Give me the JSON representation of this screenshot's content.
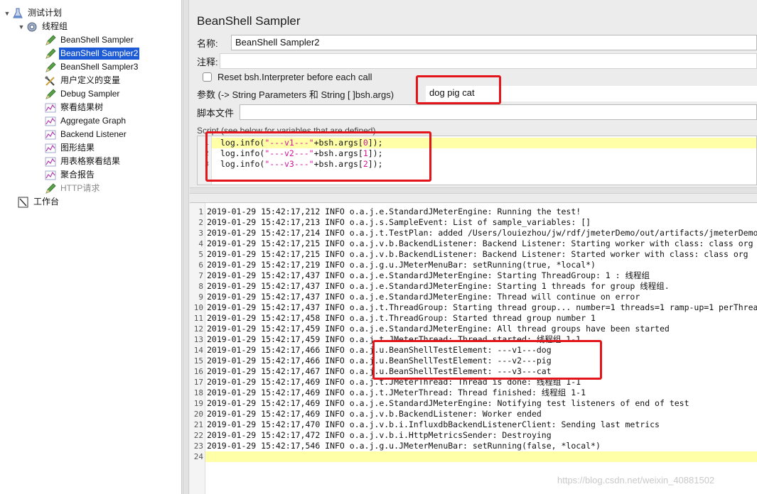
{
  "tree": {
    "root": "测试计划",
    "thread_group": "线程组",
    "items": [
      {
        "label": "BeanShell Sampler",
        "icon": "pencil-icon"
      },
      {
        "label": "BeanShell Sampler2",
        "icon": "pencil-icon",
        "selected": true
      },
      {
        "label": "BeanShell Sampler3",
        "icon": "pencil-icon"
      },
      {
        "label": "用户定义的变量",
        "icon": "tools-icon"
      },
      {
        "label": "Debug Sampler",
        "icon": "pencil-icon"
      },
      {
        "label": "察看结果树",
        "icon": "graph-icon"
      },
      {
        "label": "Aggregate Graph",
        "icon": "graph-icon"
      },
      {
        "label": "Backend Listener",
        "icon": "graph-icon"
      },
      {
        "label": "图形结果",
        "icon": "graph-icon"
      },
      {
        "label": "用表格察看结果",
        "icon": "graph-icon"
      },
      {
        "label": "聚合报告",
        "icon": "graph-icon"
      },
      {
        "label": "HTTP请求",
        "icon": "pencil-icon",
        "disabled": true
      }
    ],
    "workbench": "工作台"
  },
  "panel": {
    "title": "BeanShell Sampler",
    "name_label": "名称:",
    "name_value": "BeanShell Sampler2",
    "comment_label": "注释:",
    "reset_label": "Reset bsh.Interpreter before each call",
    "params_label": "参数 (-> String Parameters 和 String [ ]bsh.args)",
    "params_value": "dog pig cat",
    "script_file_label": "脚本文件",
    "script_label": "Script (see below for variables that are defined)",
    "script_lines": [
      {
        "num": "1",
        "pre": "log.info(",
        "str": "\"---v1---\"",
        "mid": "+bsh.args[",
        "idx": "0",
        "post": "]);"
      },
      {
        "num": "2",
        "pre": "log.info(",
        "str": "\"---v2---\"",
        "mid": "+bsh.args[",
        "idx": "1",
        "post": "]);"
      },
      {
        "num": "3",
        "pre": "log.info(",
        "str": "\"---v3---\"",
        "mid": "+bsh.args[",
        "idx": "2",
        "post": "]);"
      }
    ]
  },
  "log": {
    "lines": [
      "2019-01-29 15:42:17,212 INFO o.a.j.e.StandardJMeterEngine: Running the test!",
      "2019-01-29 15:42:17,213 INFO o.a.j.s.SampleEvent: List of sample_variables: []",
      "2019-01-29 15:42:17,214 INFO o.a.j.t.TestPlan: added /Users/louiezhou/jw/rdf/jmeterDemo/out/artifacts/jmeterDemo",
      "2019-01-29 15:42:17,215 INFO o.a.j.v.b.BackendListener: Backend Listener: Starting worker with class: class org",
      "2019-01-29 15:42:17,215 INFO o.a.j.v.b.BackendListener: Backend Listener: Started  worker with class: class org",
      "2019-01-29 15:42:17,219 INFO o.a.j.g.u.JMeterMenuBar: setRunning(true, *local*)",
      "2019-01-29 15:42:17,437 INFO o.a.j.e.StandardJMeterEngine: Starting ThreadGroup: 1 : 线程组",
      "2019-01-29 15:42:17,437 INFO o.a.j.e.StandardJMeterEngine: Starting 1 threads for group 线程组.",
      "2019-01-29 15:42:17,437 INFO o.a.j.e.StandardJMeterEngine: Thread will continue on error",
      "2019-01-29 15:42:17,437 INFO o.a.j.t.ThreadGroup: Starting thread group... number=1 threads=1 ramp-up=1 perThrea",
      "2019-01-29 15:42:17,458 INFO o.a.j.t.ThreadGroup: Started thread group number 1",
      "2019-01-29 15:42:17,459 INFO o.a.j.e.StandardJMeterEngine: All thread groups have been started",
      "2019-01-29 15:42:17,459 INFO o.a.j.t.JMeterThread: Thread started: 线程组 1-1",
      "2019-01-29 15:42:17,466 INFO o.a.j.u.BeanShellTestElement: ---v1---dog",
      "2019-01-29 15:42:17,466 INFO o.a.j.u.BeanShellTestElement: ---v2---pig",
      "2019-01-29 15:42:17,467 INFO o.a.j.u.BeanShellTestElement: ---v3---cat",
      "2019-01-29 15:42:17,469 INFO o.a.j.t.JMeterThread: Thread is done: 线程组 1-1",
      "2019-01-29 15:42:17,469 INFO o.a.j.t.JMeterThread: Thread finished: 线程组 1-1",
      "2019-01-29 15:42:17,469 INFO o.a.j.e.StandardJMeterEngine: Notifying test listeners of end of test",
      "2019-01-29 15:42:17,469 INFO o.a.j.v.b.BackendListener: Worker ended",
      "2019-01-29 15:42:17,470 INFO o.a.j.v.b.i.InfluxdbBackendListenerClient: Sending last metrics",
      "2019-01-29 15:42:17,472 INFO o.a.j.v.b.i.HttpMetricsSender: Destroying",
      "2019-01-29 15:42:17,546 INFO o.a.j.g.u.JMeterMenuBar: setRunning(false, *local*)",
      ""
    ]
  },
  "watermark": "https://blog.csdn.net/weixin_40881502",
  "colors": {
    "selection": "#1d5bd6",
    "highlight_box": "#e4141b",
    "current_line": "#ffffa8",
    "string_literal": "#d2149e"
  }
}
